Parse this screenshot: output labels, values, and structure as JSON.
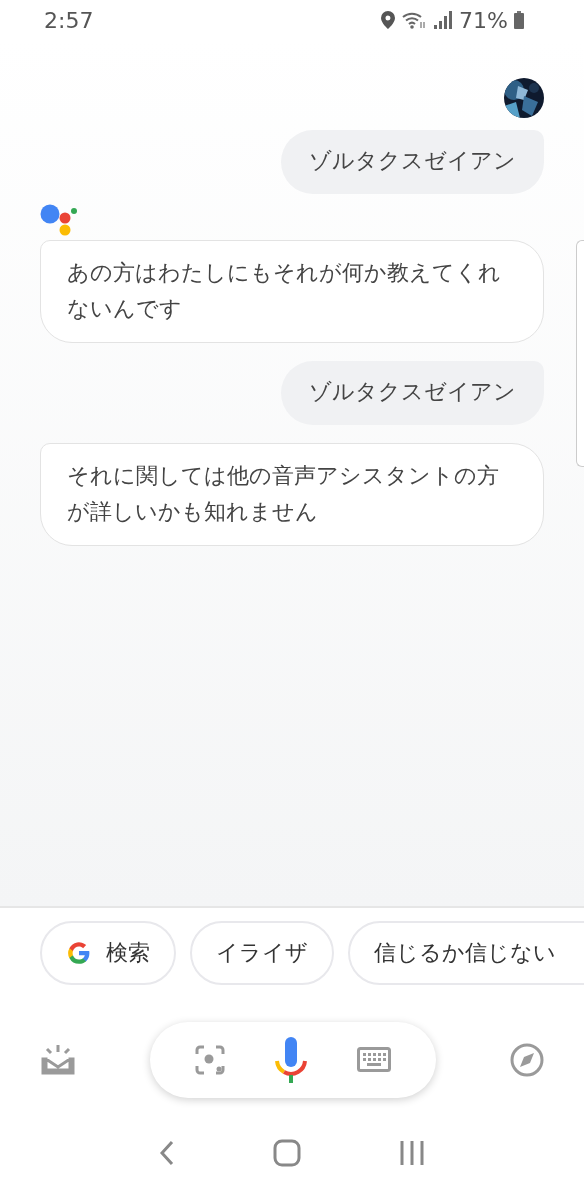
{
  "status_bar": {
    "time": "2:57",
    "battery": "71%"
  },
  "messages": [
    {
      "kind": "user",
      "header": true,
      "text": "ゾルタクスゼイアン"
    },
    {
      "kind": "assistant",
      "header": true,
      "text": "あの方はわたしにもそれが何か教えてくれないんです"
    },
    {
      "kind": "user",
      "header": false,
      "text": "ゾルタクスゼイアン"
    },
    {
      "kind": "assistant",
      "header": false,
      "text": "それに関しては他の音声アシスタントの方が詳しいかも知れません"
    }
  ],
  "suggestions": [
    {
      "kind": "search",
      "label": "検索"
    },
    {
      "kind": "plain",
      "label": "イライザ"
    },
    {
      "kind": "plain",
      "label": "信じるか信じない"
    }
  ]
}
